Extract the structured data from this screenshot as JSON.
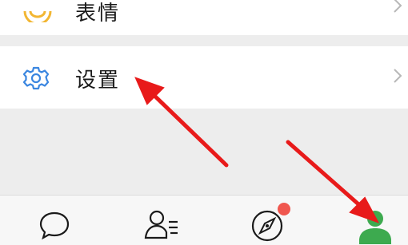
{
  "menu": {
    "emoji_label": "表情",
    "settings_label": "设置"
  },
  "colors": {
    "accent_green": "#3daa4f",
    "settings_blue": "#3a86e0",
    "emoji_yellow": "#f2b632",
    "badge_red": "#f0574f",
    "annotation_red": "#e81a1a"
  },
  "tabbar": {
    "icons": [
      "chat-bubble-icon",
      "contacts-icon",
      "compass-icon",
      "person-icon"
    ],
    "discover_has_badge": true,
    "active_tab": "me"
  }
}
